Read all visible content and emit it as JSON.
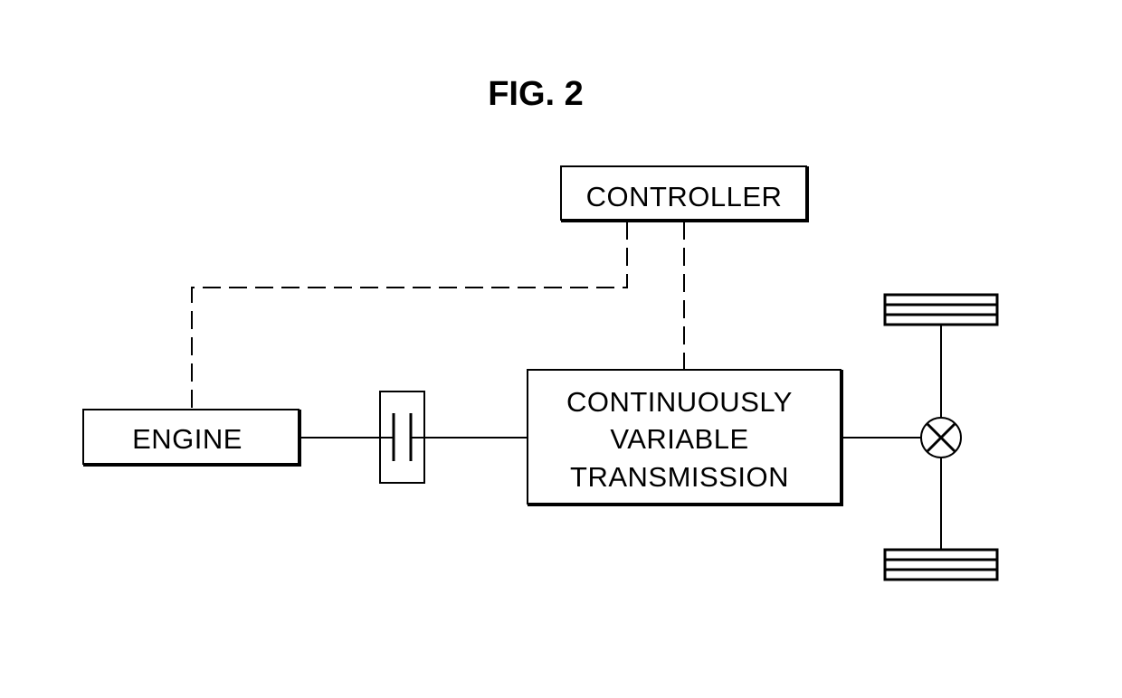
{
  "figure": {
    "title": "FIG. 2"
  },
  "components": {
    "controller": {
      "label": "CONTROLLER"
    },
    "engine": {
      "label": "ENGINE"
    },
    "clutch": {
      "symbol": "clutch-plates"
    },
    "transmission": {
      "label_lines": [
        "CONTINUOUSLY",
        "VARIABLE",
        "TRANSMISSION"
      ]
    },
    "differential": {
      "symbol": "circle-x"
    },
    "wheels": [
      {
        "position": "top"
      },
      {
        "position": "bottom"
      }
    ]
  },
  "connections": [
    {
      "from": "controller",
      "to": "engine",
      "type": "control-signal",
      "style": "dashed"
    },
    {
      "from": "controller",
      "to": "transmission",
      "type": "control-signal",
      "style": "dashed"
    },
    {
      "from": "engine",
      "to": "clutch",
      "type": "mechanical",
      "style": "solid"
    },
    {
      "from": "clutch",
      "to": "transmission",
      "type": "mechanical",
      "style": "solid"
    },
    {
      "from": "transmission",
      "to": "differential",
      "type": "mechanical",
      "style": "solid"
    },
    {
      "from": "differential",
      "to": "wheel-top",
      "type": "axle",
      "style": "solid"
    },
    {
      "from": "differential",
      "to": "wheel-bottom",
      "type": "axle",
      "style": "solid"
    }
  ]
}
